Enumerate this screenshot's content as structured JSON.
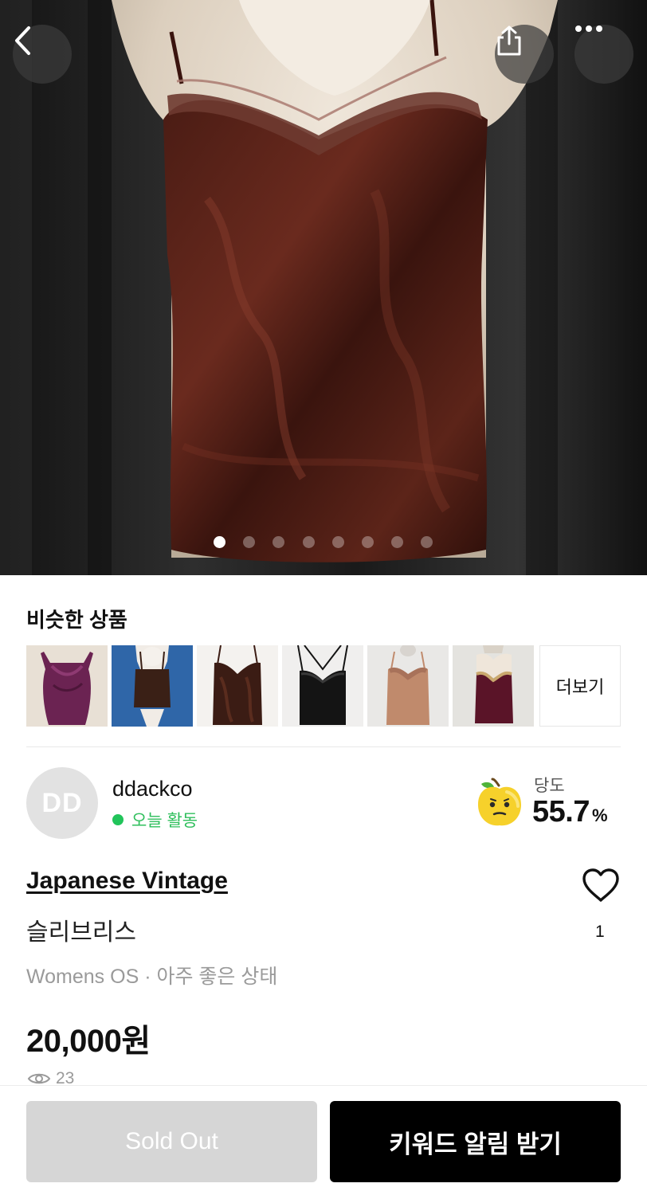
{
  "hero": {
    "image_icon": "camisole-photo",
    "page_count": 8,
    "active_page": 1
  },
  "navigation": {
    "back_icon": "chevron-left-icon",
    "share_icon": "share-icon",
    "more_icon": "more-dots-icon"
  },
  "similar": {
    "title": "비슷한 상품",
    "more_label": "더보기",
    "items": [
      {
        "icon": "thumb-purple-cowl-top",
        "color": "#6b2352"
      },
      {
        "icon": "thumb-brown-cami-on-mannequin",
        "color": "#3a2016"
      },
      {
        "icon": "thumb-brown-velvet-cami",
        "color": "#3b1c14"
      },
      {
        "icon": "thumb-black-strappy-cami",
        "color": "#141414"
      },
      {
        "icon": "thumb-tan-lace-cami",
        "color": "#c08a6c"
      },
      {
        "icon": "thumb-burgundy-velvet-cami",
        "color": "#5a1428"
      }
    ]
  },
  "seller": {
    "avatar_initials": "DD",
    "name": "ddackco",
    "activity": "오늘 활동",
    "sweetness_label": "당도",
    "sweetness_value": "55.7",
    "sweetness_unit": "%"
  },
  "product": {
    "brand": "Japanese Vintage",
    "name": "슬리브리스",
    "meta": "Womens OS · 아주 좋은 상태",
    "price": "20,000원",
    "views": "23",
    "likes": "1"
  },
  "actions": {
    "sold_out": "Sold Out",
    "keyword_alert": "키워드 알림 받기"
  },
  "colors": {
    "accent_green": "#21c45a",
    "primary_button": "#000000",
    "disabled_button": "#d6d6d6"
  }
}
